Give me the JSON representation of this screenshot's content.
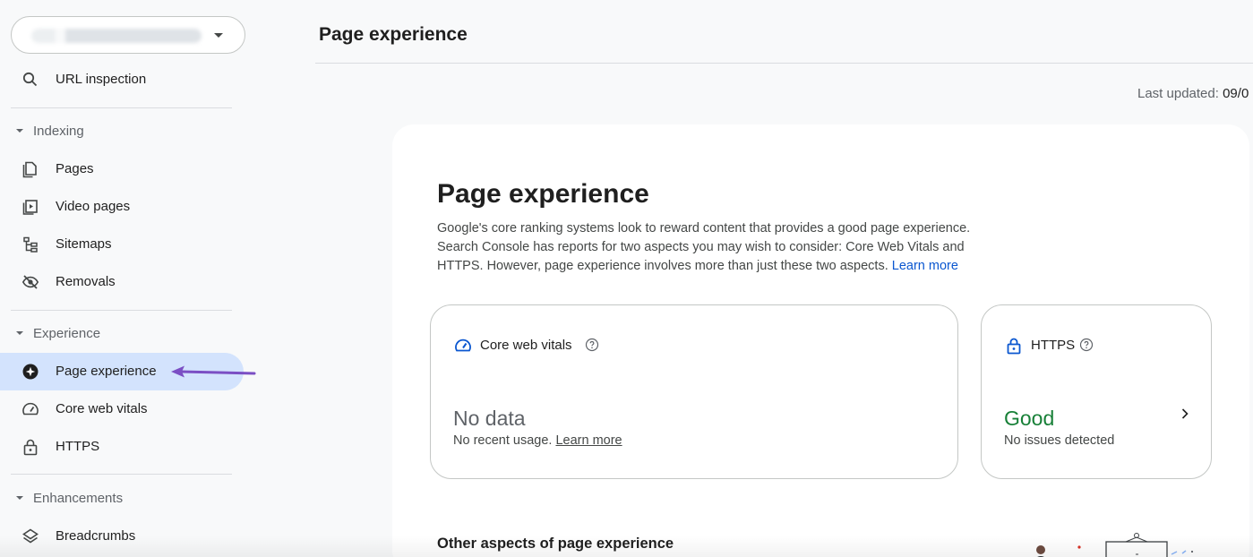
{
  "sidebar": {
    "url_inspection": "URL inspection",
    "sections": {
      "indexing": "Indexing",
      "experience": "Experience",
      "enhancements": "Enhancements"
    },
    "indexing_items": [
      "Pages",
      "Video pages",
      "Sitemaps",
      "Removals"
    ],
    "experience_items": [
      "Page experience",
      "Core web vitals",
      "HTTPS"
    ],
    "enhancement_items": [
      "Breadcrumbs"
    ],
    "active_item": "Page experience"
  },
  "header": {
    "title": "Page experience",
    "last_updated_label": "Last updated:",
    "last_updated_value": "09/0"
  },
  "main": {
    "title": "Page experience",
    "description": "Google's core ranking systems look to reward content that provides a good page experience. Search Console has reports for two aspects you may wish to consider: Core Web Vitals and HTTPS. However, page experience involves more than just these two aspects.",
    "learn_more": "Learn more",
    "core_web_vitals": {
      "title": "Core web vitals",
      "status": "No data",
      "detail": "No recent usage.",
      "link": "Learn more"
    },
    "https": {
      "title": "HTTPS",
      "status": "Good",
      "detail": "No issues detected"
    },
    "other_aspects": "Other aspects of page experience"
  },
  "colors": {
    "accent_blue": "#0b57d0",
    "active_bg": "#d3e3fd",
    "good_green": "#188038",
    "annotation_arrow": "#7b4fc4"
  }
}
